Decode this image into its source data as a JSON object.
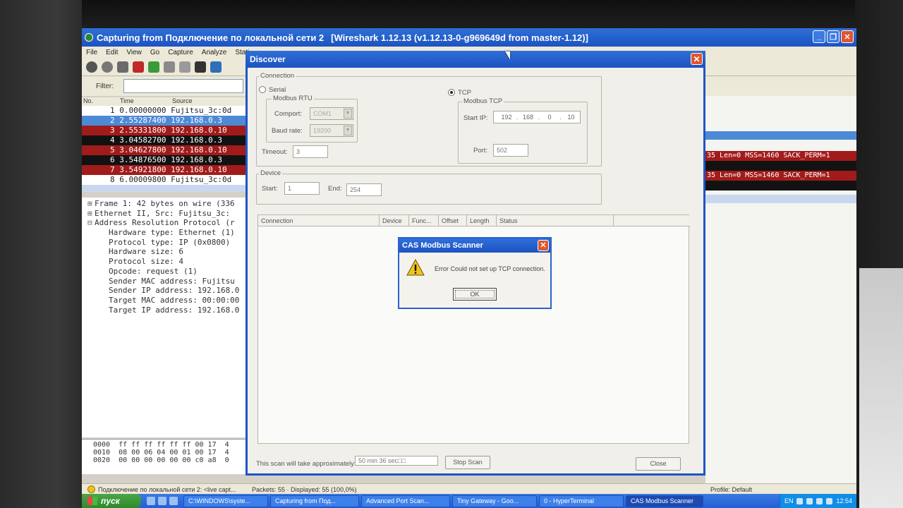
{
  "wireshark": {
    "title": "Capturing from Подключение по локальной сети 2",
    "version": "[Wireshark 1.12.13  (v1.12.13-0-g969649d from master-1.12)]",
    "menu": [
      "File",
      "Edit",
      "View",
      "Go",
      "Capture",
      "Analyze",
      "Stati"
    ],
    "filter_label": "Filter:",
    "columns": [
      "No.",
      "Time",
      "Source"
    ],
    "packets": [
      {
        "text": "1 0.00000000 Fujitsu_3c:0d",
        "style": "n"
      },
      {
        "text": "2 2.55287400 192.168.0.3",
        "style": "sel"
      },
      {
        "text": "3 2.55331800 192.168.0.10",
        "style": "red"
      },
      {
        "text": "4 3.04582700 192.168.0.3",
        "style": "blk"
      },
      {
        "text": "5 3.04627800 192.168.0.10",
        "style": "red"
      },
      {
        "text": "6 3.54876500 192.168.0.3",
        "style": "blk"
      },
      {
        "text": "7 3.54921800 192.168.0.10",
        "style": "red"
      },
      {
        "text": "8 6.00009800 Fujitsu_3c:0d",
        "style": "n"
      }
    ],
    "details": [
      "Frame 1: 42 bytes on wire (336",
      "Ethernet II, Src: Fujitsu_3c:",
      "Address Resolution Protocol (r",
      "Hardware type: Ethernet (1)",
      "Protocol type: IP (0x0800)",
      "Hardware size: 6",
      "Protocol size: 4",
      "Opcode: request (1)",
      "Sender MAC address: Fujitsu",
      "Sender IP address: 192.168.0",
      "Target MAC address: 00:00:00",
      "Target IP address: 192.168.0"
    ],
    "hex": [
      "0000  ff ff ff ff ff ff 00 17  4",
      "0010  08 00 06 04 00 01 00 17  4",
      "0020  00 00 00 00 00 00 c0 a8  0"
    ],
    "info_lines": [
      "35 Len=0 MSS=1460 SACK_PERM=1",
      "35 Len=0 MSS=1460 SACK_PERM=1"
    ],
    "status": {
      "interface": "Подключение по локальной сети 2: <live capt...",
      "packets": "Packets: 55 · Displayed: 55 (100,0%)",
      "profile": "Profile: Default"
    }
  },
  "discover": {
    "title": "Discover",
    "connection_label": "Connection",
    "serial_label": "Serial",
    "modbus_rtu_label": "Modbus RTU",
    "comport_label": "Comport:",
    "comport_value": "COM1",
    "baud_label": "Baud rate:",
    "baud_value": "19200",
    "timeout_label": "Timeout:",
    "timeout_value": "3",
    "tcp_label": "TCP",
    "modbus_tcp_label": "Modbus TCP",
    "start_ip_label": "Start IP:",
    "ip": [
      "192",
      "168",
      "0",
      "10"
    ],
    "port_label": "Port:",
    "port_value": "502",
    "device_label": "Device",
    "start_label": "Start:",
    "start_value": "1",
    "end_label": "End:",
    "end_value": "254",
    "list_columns": [
      "Connection",
      "Device",
      "Func...",
      "Offset",
      "Length",
      "Status"
    ],
    "scan_time_label": "This scan will take approximately:",
    "scan_time_value": "50 min 36 sec□□",
    "stop_scan": "Stop Scan",
    "close": "Close"
  },
  "msgbox": {
    "title": "CAS Modbus Scanner",
    "message": "Error Could not set up TCP connection.",
    "ok": "OK"
  },
  "taskbar": {
    "start": "пуск",
    "tasks": [
      {
        "label": "C:\\WINDOWS\\syste...",
        "active": false
      },
      {
        "label": "Capturing from Под...",
        "active": false
      },
      {
        "label": "Advanced Port Scan...",
        "active": false
      },
      {
        "label": "Tiny Gateway - Goo...",
        "active": false
      },
      {
        "label": "0 - HyperTerminal",
        "active": false
      },
      {
        "label": "CAS Modbus Scanner",
        "active": true
      }
    ],
    "lang": "EN",
    "clock": "12:54"
  },
  "colors": {
    "xp_blue": "#1c53c1",
    "pkt_red": "#a21b1b",
    "pkt_selected": "#4d8ad6",
    "warning": "#f0c020"
  }
}
